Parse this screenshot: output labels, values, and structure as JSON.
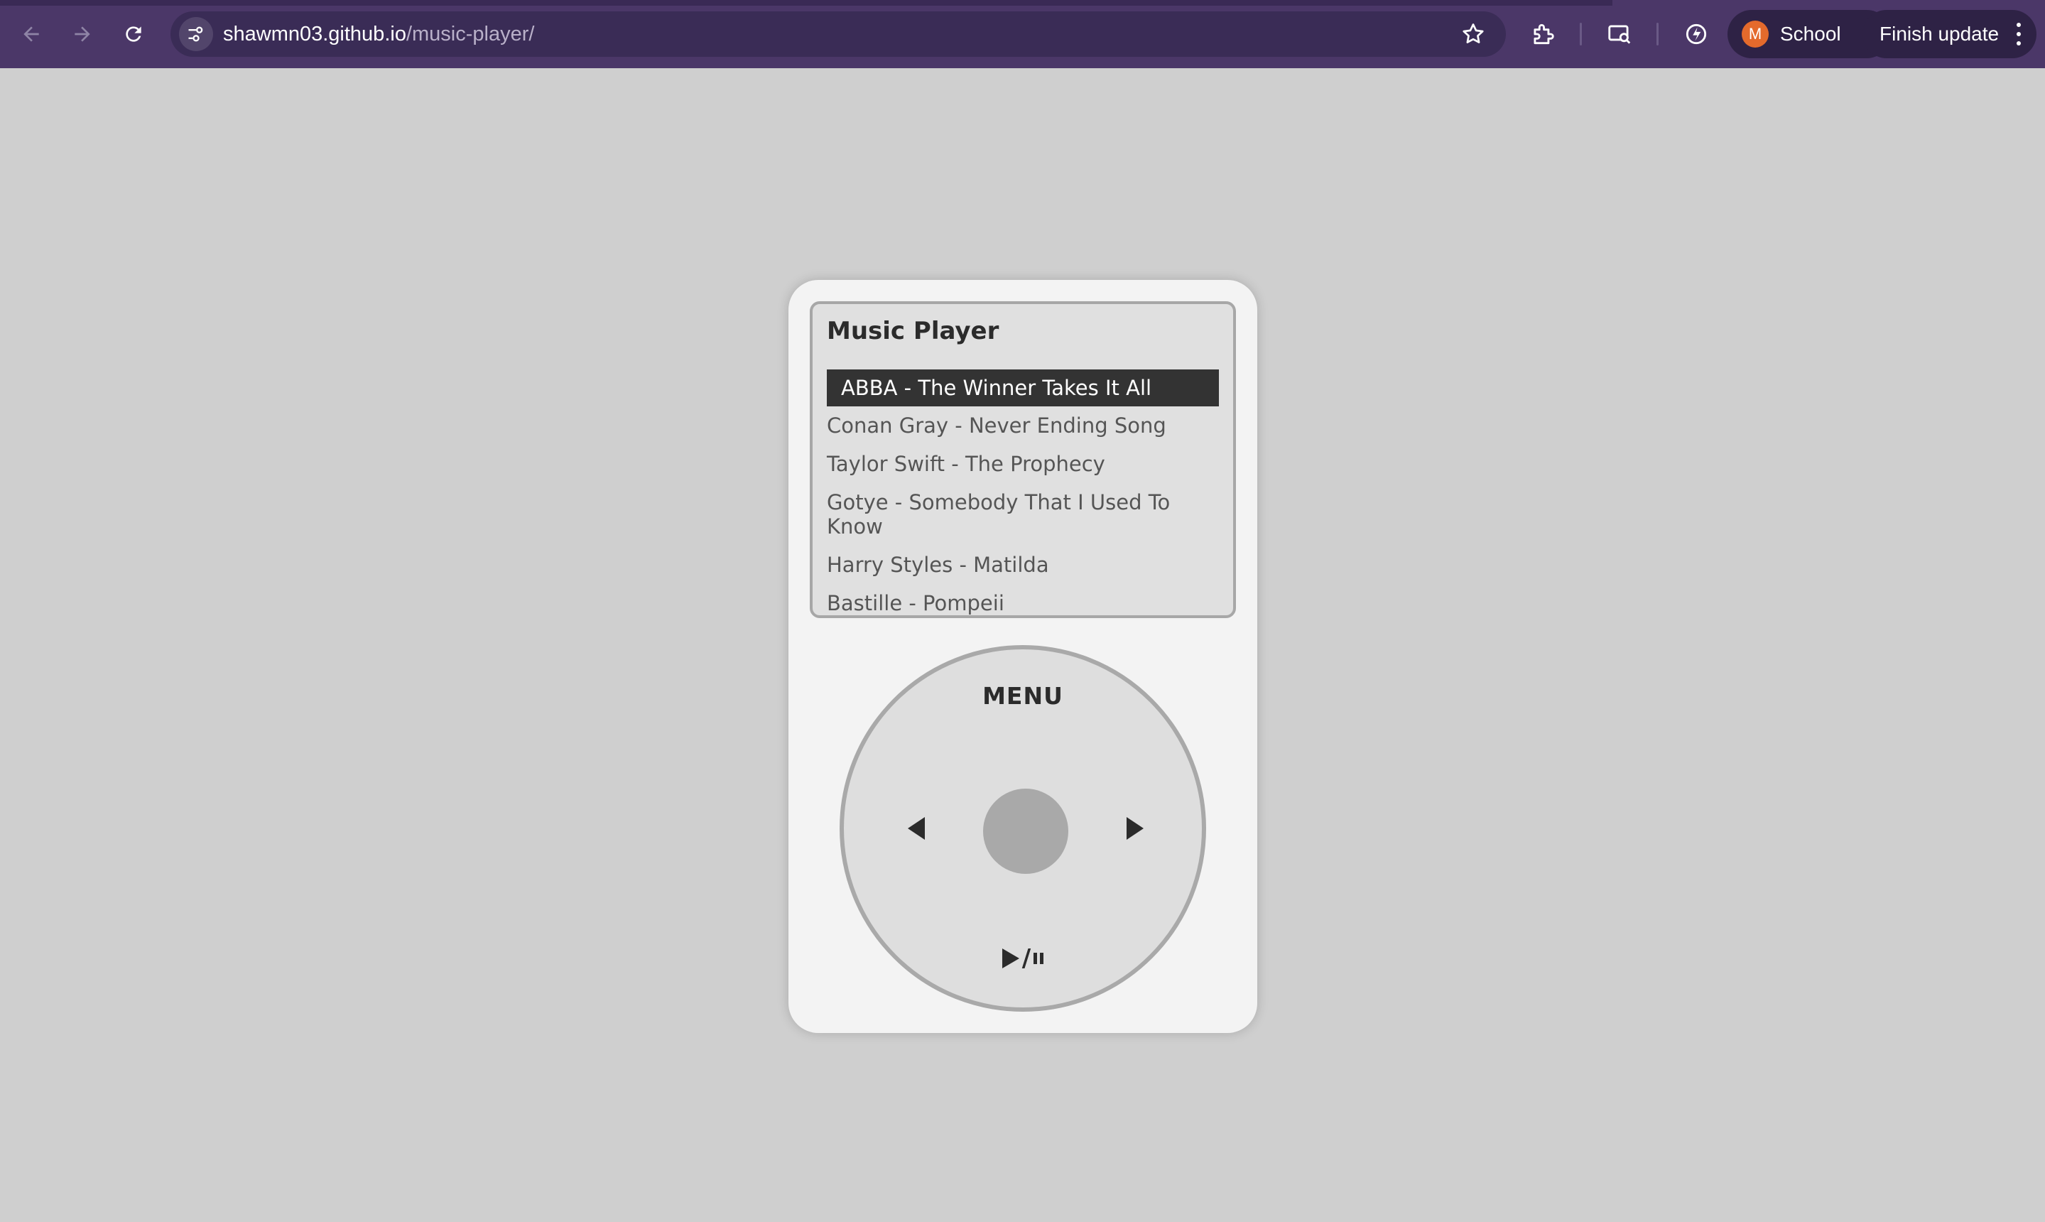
{
  "browser": {
    "url_host": "shawmn03.github.io",
    "url_path": "/music-player/",
    "profile": {
      "initial": "M",
      "label": "School"
    },
    "update_label": "Finish update",
    "icons": [
      "back-arrow-icon",
      "forward-arrow-icon",
      "reload-icon",
      "site-settings-icon",
      "bookmark-star-icon",
      "extensions-icon",
      "screen-search-icon",
      "performance-icon",
      "more-vert-icon"
    ]
  },
  "player": {
    "title": "Music Player",
    "songs": [
      "ABBA - The Winner Takes It All",
      "Conan Gray - Never Ending Song",
      "Taylor Swift - The Prophecy",
      "Gotye - Somebody That I Used To Know",
      "Harry Styles - Matilda",
      "Bastille - Pompeii"
    ],
    "selected_index": 0,
    "wheel": {
      "menu_label": "MENU",
      "play_pause_separator": "/"
    }
  },
  "colors": {
    "chrome_bg": "#4b3768",
    "page_bg": "#cfcfcf",
    "ipod_body": "#f3f3f3",
    "screen_bg": "#e0e0e0",
    "selected_bg": "#333333",
    "avatar": "#e46a2c"
  }
}
